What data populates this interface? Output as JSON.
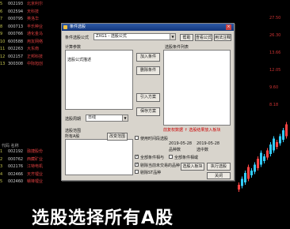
{
  "bg_table": {
    "rows": [
      {
        "no": "5",
        "code": "002193",
        "name": "北京利尔"
      },
      {
        "no": "6",
        "code": "002594",
        "name": "天科技"
      },
      {
        "no": "7",
        "code": "000795",
        "name": "英洛华"
      },
      {
        "no": "8",
        "code": "000713",
        "name": "丰乐种业"
      },
      {
        "no": "9",
        "code": "000766",
        "name": "通化金马"
      },
      {
        "no": "10",
        "code": "600588",
        "name": "用友网络"
      },
      {
        "no": "11",
        "code": "002263",
        "name": "大东南"
      },
      {
        "no": "12",
        "code": "002157",
        "name": "正邦科技"
      },
      {
        "no": "13",
        "code": "300308",
        "name": "中际旭创"
      }
    ],
    "lower_rows": [
      {
        "no": "1",
        "code": "002192",
        "name": "融捷股份"
      },
      {
        "no": "2",
        "code": "000762",
        "name": "西藏矿业"
      },
      {
        "no": "3",
        "code": "002176",
        "name": "江特电机"
      },
      {
        "no": "4",
        "code": "002466",
        "name": "天齐锂业"
      },
      {
        "no": "5",
        "code": "002460",
        "name": "赣锋锂业"
      }
    ],
    "lower_header": "代码  名称"
  },
  "right_bg": {
    "values": [
      "27.50",
      "26.30",
      "13.66",
      "12.05",
      "9.60",
      "8.18"
    ]
  },
  "dialog": {
    "title": "条件选股",
    "formula_label": "条件选股公式",
    "formula_value": "ZXG1 - 选股公式",
    "params_label": "计算参数",
    "formula_desc_label": "选股公式描述",
    "right_buttons": [
      "帮助",
      "查看公式",
      "用法注释"
    ],
    "condition_list_label": "选股条件列表",
    "middle_buttons": [
      "加入条件",
      "删除条件",
      "引入方案",
      "保存方案"
    ],
    "period_label": "选股周期",
    "period_value": "日线",
    "scope_label": "选股范围",
    "scope_note": "所有A股",
    "change_scope_button": "改变范围",
    "red_note": "前复权数据 ↑ 选股结果放入板块",
    "checkbox_time_label": "使用时间段选股",
    "date_from": "2019-05-28",
    "date_to": "2019-05-28",
    "checkbox_options": [
      {
        "label": "全部条件相与",
        "checked": true
      },
      {
        "label": "全部条件相或",
        "checked": false
      },
      {
        "label": "剔除当前未交易的品种",
        "checked": true
      },
      {
        "label": "剔除ST品种",
        "checked": false
      }
    ],
    "bottom_buttons": [
      "选股入板块",
      "执行选股",
      "关闭"
    ],
    "result_label": "品种数",
    "result_label2": "选中数"
  },
  "banner_text": "选股选择所有A股"
}
